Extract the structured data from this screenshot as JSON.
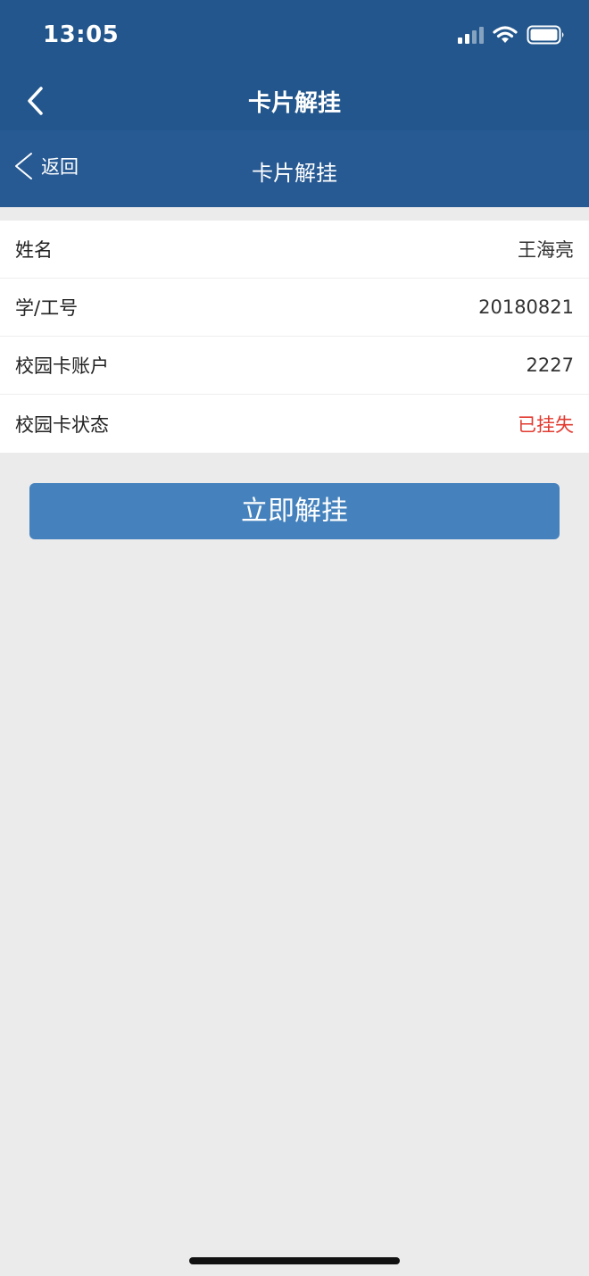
{
  "status_bar": {
    "time": "13:05",
    "icons": [
      "cellular-signal-icon",
      "wifi-icon",
      "battery-icon"
    ]
  },
  "header": {
    "title": "卡片解挂",
    "back_icon": "chevron-left-icon"
  },
  "sub_header": {
    "back_label": "返回",
    "title": "卡片解挂"
  },
  "info": {
    "rows": [
      {
        "label": "姓名",
        "value": "王海亮"
      },
      {
        "label": "学/工号",
        "value": "20180821"
      },
      {
        "label": "校园卡账户",
        "value": "2227"
      },
      {
        "label": "校园卡状态",
        "value": "已挂失"
      }
    ]
  },
  "actions": {
    "unhang_label": "立即解挂"
  },
  "colors": {
    "header_bg": "#22568c",
    "sub_header_bg": "#275a93",
    "button_bg": "#4582bd",
    "status_alert": "#e23b30",
    "page_bg": "#ebebeb"
  }
}
